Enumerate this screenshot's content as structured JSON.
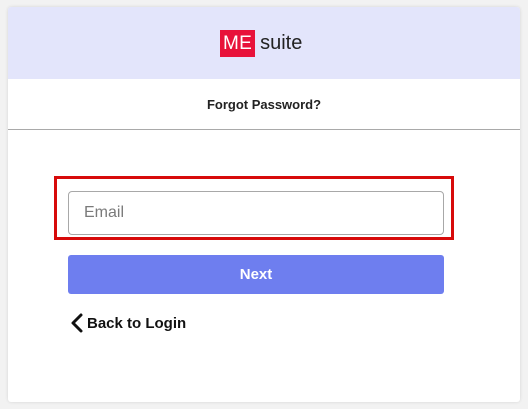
{
  "brand": {
    "logo_box_text": "ME",
    "logo_text": "suite",
    "logo_box_color": "#e8123a",
    "header_bg": "#e3e5fb"
  },
  "page": {
    "title": "Forgot Password?"
  },
  "form": {
    "email_placeholder": "Email",
    "email_value": "",
    "next_label": "Next",
    "next_color": "#6e7eef",
    "highlight_color": "#d70a0a"
  },
  "nav": {
    "back_label": "Back to Login",
    "back_icon": "chevron-left-icon"
  }
}
